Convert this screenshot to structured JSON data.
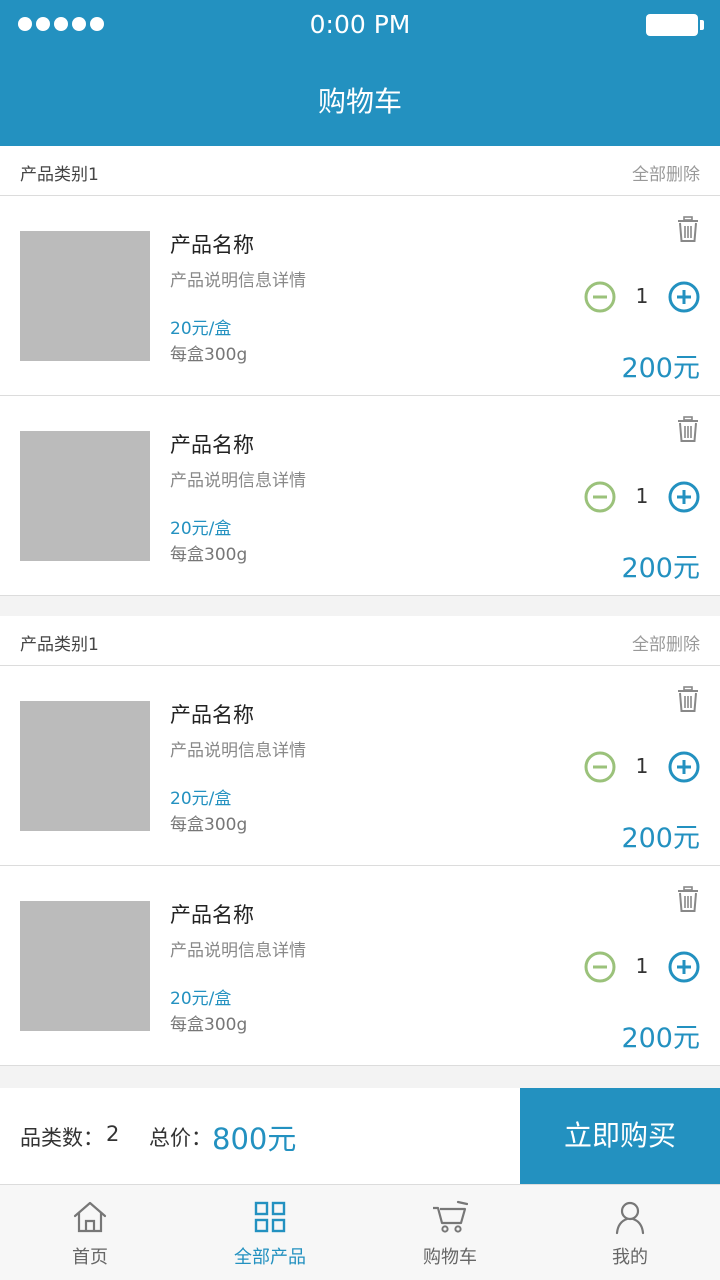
{
  "status_bar": {
    "time": "0:00 PM",
    "signal_icon": "signal-dots-icon",
    "battery_icon": "battery-icon"
  },
  "header": {
    "title": "购物车"
  },
  "groups": [
    {
      "name": "产品类别1",
      "delete_all": "全部删除",
      "items": [
        {
          "name": "产品名称",
          "desc": "产品说明信息详情",
          "price": "20元/盒",
          "weight": "每盒300g",
          "qty": "1",
          "subtotal": "200元"
        },
        {
          "name": "产品名称",
          "desc": "产品说明信息详情",
          "price": "20元/盒",
          "weight": "每盒300g",
          "qty": "1",
          "subtotal": "200元"
        }
      ]
    },
    {
      "name": "产品类别1",
      "delete_all": "全部删除",
      "items": [
        {
          "name": "产品名称",
          "desc": "产品说明信息详情",
          "price": "20元/盒",
          "weight": "每盒300g",
          "qty": "1",
          "subtotal": "200元"
        },
        {
          "name": "产品名称",
          "desc": "产品说明信息详情",
          "price": "20元/盒",
          "weight": "每盒300g",
          "qty": "1",
          "subtotal": "200元"
        }
      ]
    }
  ],
  "summary": {
    "count_label": "品类数：",
    "count_value": "2",
    "total_label": "总价：",
    "total_value": "800元",
    "buy_button": "立即购买"
  },
  "tabs": [
    {
      "label": "首页",
      "icon": "home-icon",
      "active": false
    },
    {
      "label": "全部产品",
      "icon": "grid-icon",
      "active": true
    },
    {
      "label": "购物车",
      "icon": "cart-icon",
      "active": false
    },
    {
      "label": "我的",
      "icon": "user-icon",
      "active": false
    }
  ],
  "colors": {
    "primary": "#2391c0",
    "minus_green": "#9bc27b",
    "thumb_gray": "#bbbbbb",
    "page_bg": "#f3f3f3"
  }
}
